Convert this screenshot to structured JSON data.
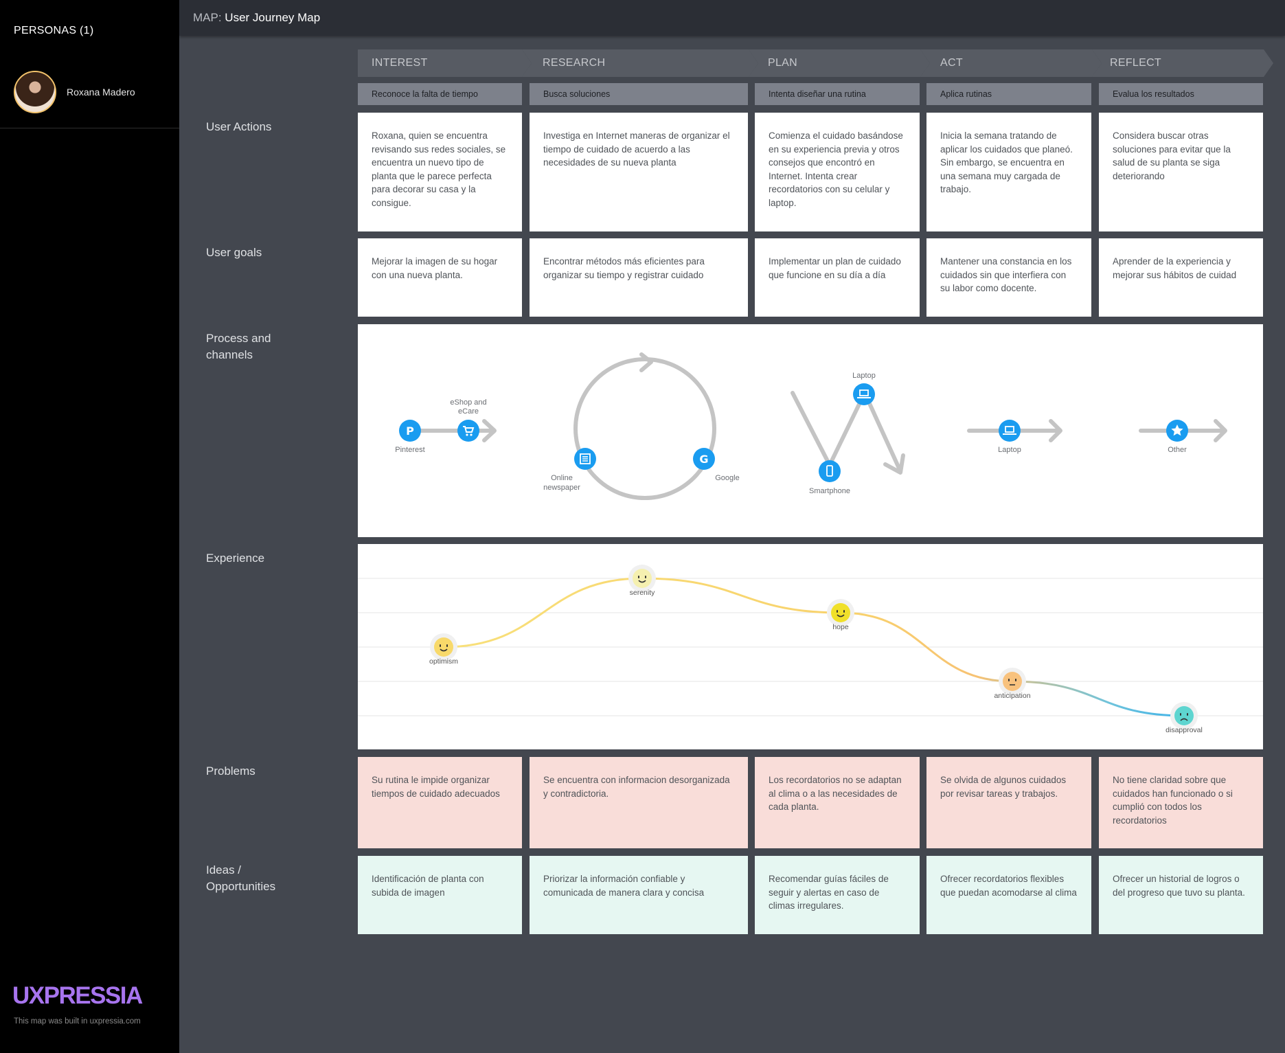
{
  "sidebar": {
    "personas_title": "PERSONAS (1)",
    "persona_name": "Roxana Madero",
    "brand": "UXPRESSIA",
    "brand_note": "This map was built in uxpressia.com"
  },
  "header": {
    "map_prefix": "MAP:",
    "map_title": "User Journey Map"
  },
  "phases": [
    "INTEREST",
    "RESEARCH",
    "PLAN",
    "ACT",
    "REFLECT"
  ],
  "stages": [
    "Reconoce la falta de tiempo",
    "Busca soluciones",
    "Intenta diseñar una rutina",
    "Aplica rutinas",
    "Evalua los resultados"
  ],
  "rows": {
    "user_actions": {
      "label": "User Actions",
      "cells": [
        "Roxana, quien se encuentra revisando sus redes sociales, se encuentra un nuevo tipo de planta que le parece perfecta para decorar su casa y la consigue.",
        "Investiga en Internet maneras de organizar el tiempo de cuidado de acuerdo a las necesidades de su nueva planta",
        "Comienza el cuidado basándose en su experiencia previa y otros consejos que encontró en Internet. Intenta crear recordatorios con su celular y laptop.",
        "Inicia la semana tratando de aplicar los cuidados que planeó. Sin embargo, se encuentra en una semana muy cargada de trabajo.",
        "Considera buscar otras soluciones para evitar que la salud de su planta se siga deteriorando"
      ]
    },
    "user_goals": {
      "label": "User goals",
      "cells": [
        "Mejorar la imagen de su hogar con una nueva planta.",
        "Encontrar métodos más eficientes para organizar su tiempo y registrar cuidado",
        "Implementar un plan de cuidado que funcione en su día a día",
        "Mantener una constancia en los cuidados sin que interfiera con su labor como docente.",
        "Aprender de la experiencia y mejorar sus hábitos de cuidad"
      ]
    },
    "process": {
      "label_line1": "Process and",
      "label_line2": "channels",
      "channels": {
        "pinterest": "Pinterest",
        "eshop_line1": "eShop and",
        "eshop_line2": "eCare",
        "newspaper_line1": "Online",
        "newspaper_line2": "newspaper",
        "google": "Google",
        "laptop_plan": "Laptop",
        "smartphone": "Smartphone",
        "laptop_act": "Laptop",
        "other": "Other"
      },
      "accent_color": "#1a9cf0",
      "line_color": "#c4c4c4"
    },
    "experience": {
      "label": "Experience",
      "points": [
        {
          "emotion": "optimism",
          "level": 3
        },
        {
          "emotion": "serenity",
          "level": 5
        },
        {
          "emotion": "hope",
          "level": 4
        },
        {
          "emotion": "anticipation",
          "level": 2
        },
        {
          "emotion": "disapproval",
          "level": 1
        }
      ],
      "levels": 6,
      "colors": {
        "optimism": "#f8d96a",
        "serenity": "#f5f0b0",
        "hope": "#f0e02a",
        "anticipation": "#f8c27e",
        "disapproval": "#5ed5d0"
      }
    },
    "problems": {
      "label": "Problems",
      "cells": [
        "Su rutina le impide organizar tiempos de cuidado adecuados",
        "Se encuentra con  informacion desorganizada y contradictoria.",
        "Los recordatorios no se adaptan al clima o a las necesidades de cada planta.",
        "Se olvida de algunos cuidados por revisar tareas y trabajos.",
        "No tiene claridad sobre que cuidados han funcionado o si cumplió con todos los recordatorios"
      ]
    },
    "ideas": {
      "label_line1": "Ideas /",
      "label_line2": "Opportunities",
      "cells": [
        "Identificación de planta con subida de imagen",
        "Priorizar la información confiable y comunicada de manera clara y concisa",
        "Recomendar guías fáciles de seguir y alertas en caso de climas irregulares.",
        "Ofrecer recordatorios flexibles que puedan acomodarse al clima",
        "Ofrecer un historial de logros o del progreso que tuvo su planta."
      ]
    }
  }
}
